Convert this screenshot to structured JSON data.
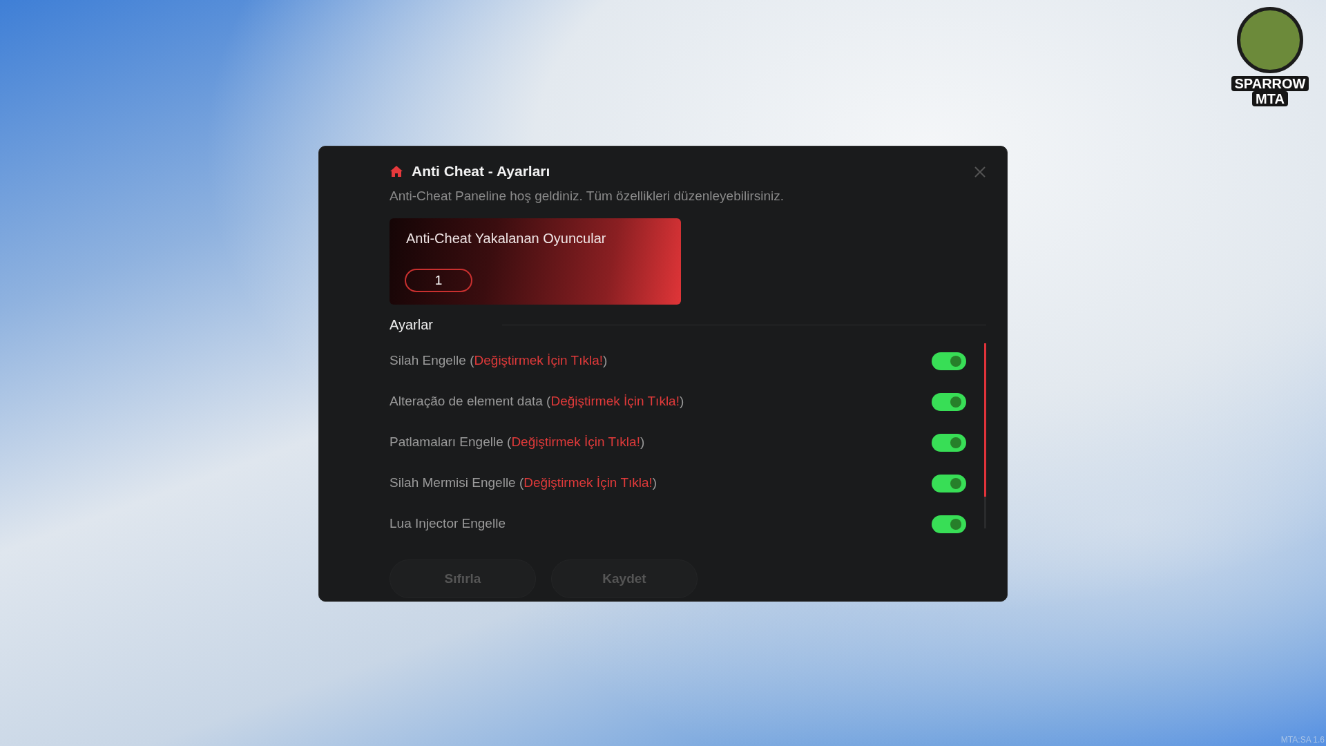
{
  "logo": {
    "line_1": "SPARROW",
    "line_2": "MTA"
  },
  "dialog": {
    "title": "Anti Cheat - Ayarları",
    "subtitle": "Anti-Cheat Paneline hoş geldiniz. Tüm özellikleri düzenleyebilirsiniz.",
    "stat_card": {
      "label": "Anti-Cheat Yakalanan Oyuncular",
      "count": "1"
    },
    "section_title": "Ayarlar",
    "settings": [
      {
        "label": "Silah Engelle (",
        "link": "Değiştirmek İçin Tıkla!",
        "after": ")",
        "on": true
      },
      {
        "label": "Alteração de element data (",
        "link": "Değiştirmek İçin Tıkla!",
        "after": ")",
        "on": true
      },
      {
        "label": "Patlamaları Engelle (",
        "link": "Değiştirmek İçin Tıkla!",
        "after": ")",
        "on": true
      },
      {
        "label": "Silah Mermisi Engelle (",
        "link": "Değiştirmek İçin Tıkla!",
        "after": ")",
        "on": true
      },
      {
        "label": "Lua Injector Engelle",
        "on": true
      }
    ],
    "buttons": [
      "Sıfırla",
      "Kaydet"
    ]
  },
  "version": "MTA:SA 1.6"
}
